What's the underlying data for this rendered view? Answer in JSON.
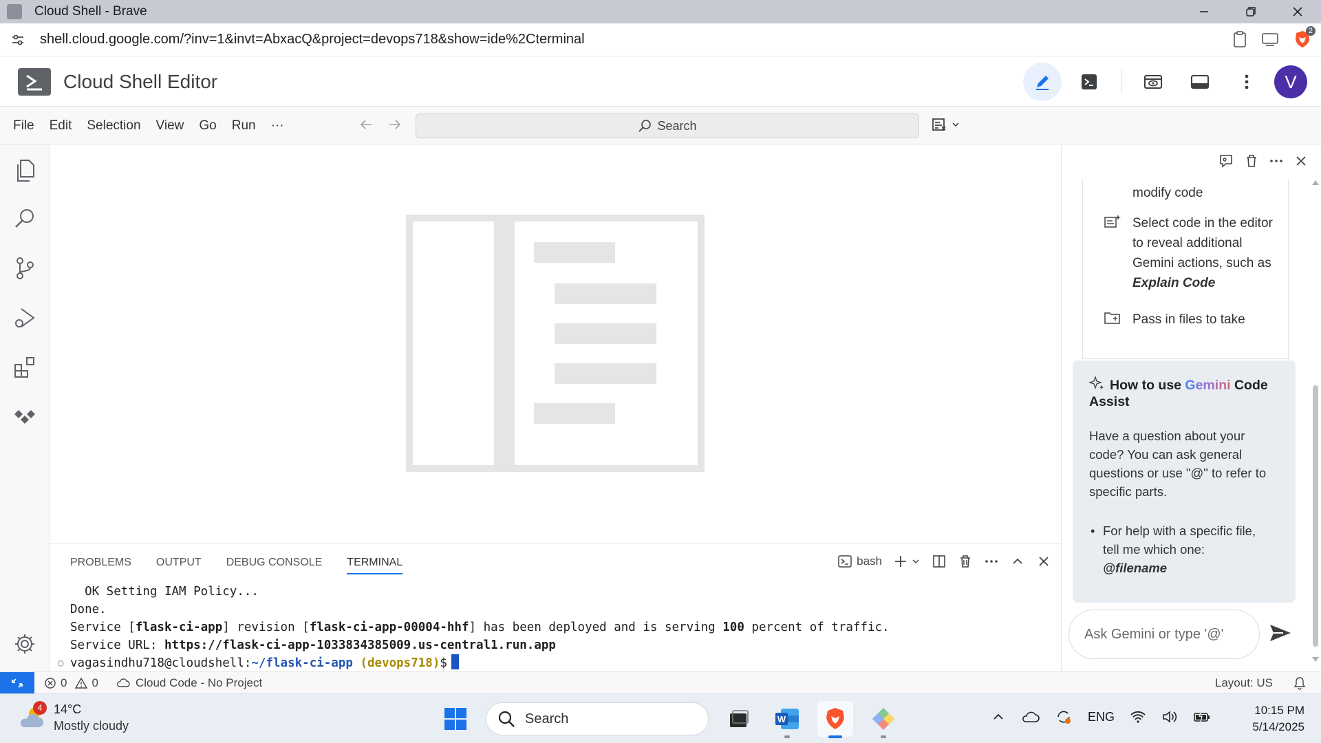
{
  "browser": {
    "window_title": "Cloud Shell - Brave",
    "url": "shell.cloud.google.com/?inv=1&invt=AbxacQ&project=devops718&show=ide%2Cterminal",
    "shields_count": "2"
  },
  "header": {
    "product_name": "Cloud Shell Editor",
    "avatar_letter": "V"
  },
  "menubar": {
    "items": [
      "File",
      "Edit",
      "Selection",
      "View",
      "Go",
      "Run",
      "···"
    ],
    "search_label": "Search"
  },
  "panel": {
    "tabs": [
      "PROBLEMS",
      "OUTPUT",
      "DEBUG CONSOLE",
      "TERMINAL"
    ],
    "active_tab": "TERMINAL",
    "shell_name": "bash"
  },
  "terminal": {
    "line1": "  OK Setting IAM Policy...",
    "line2": "Done.",
    "line3_a": "Service [",
    "line3_b": "flask-ci-app",
    "line3_c": "] revision [",
    "line3_d": "flask-ci-app-00004-hhf",
    "line3_e": "] has been deployed and is serving ",
    "line3_f": "100",
    "line3_g": " percent of traffic.",
    "line4_a": "Service URL: ",
    "line4_b": "https://flask-ci-app-1033834385009.us-central1.run.app",
    "prompt_user": "vagasindhu718@cloudshell:",
    "prompt_path": "~/flask-ci-app",
    "prompt_project": " (devops718)",
    "prompt_symbol": "$"
  },
  "gemini": {
    "tip0": "modify code",
    "tip1_a": "Select code in the editor to reveal additional Gemini actions, such as ",
    "tip1_b": "Explain Code",
    "tip2": "Pass in files to take",
    "howto_prefix": "How to use ",
    "howto_gemini": "Gemini",
    "howto_suffix": " Code Assist",
    "howto_body": "Have a question about your code? You can ask general questions or use \"@\" to refer to specific parts.",
    "bullet_a": "For help with a specific file, tell me which one: ",
    "bullet_b": "@filename",
    "ask_placeholder": "Ask Gemini or type '@'"
  },
  "statusbar": {
    "errors": "0",
    "warnings": "0",
    "cloud_code": "Cloud Code - No Project",
    "layout": "Layout: US"
  },
  "taskbar": {
    "weather_badge": "4",
    "temperature": "14°C",
    "weather_desc": "Mostly cloudy",
    "search_label": "Search",
    "lang": "ENG",
    "time": "10:15 PM",
    "date": "5/14/2025"
  },
  "colors": {
    "accent": "#1a73e8",
    "avatar": "#4b2fa8",
    "prompt_path": "#2456b3",
    "prompt_project": "#a58a00"
  }
}
